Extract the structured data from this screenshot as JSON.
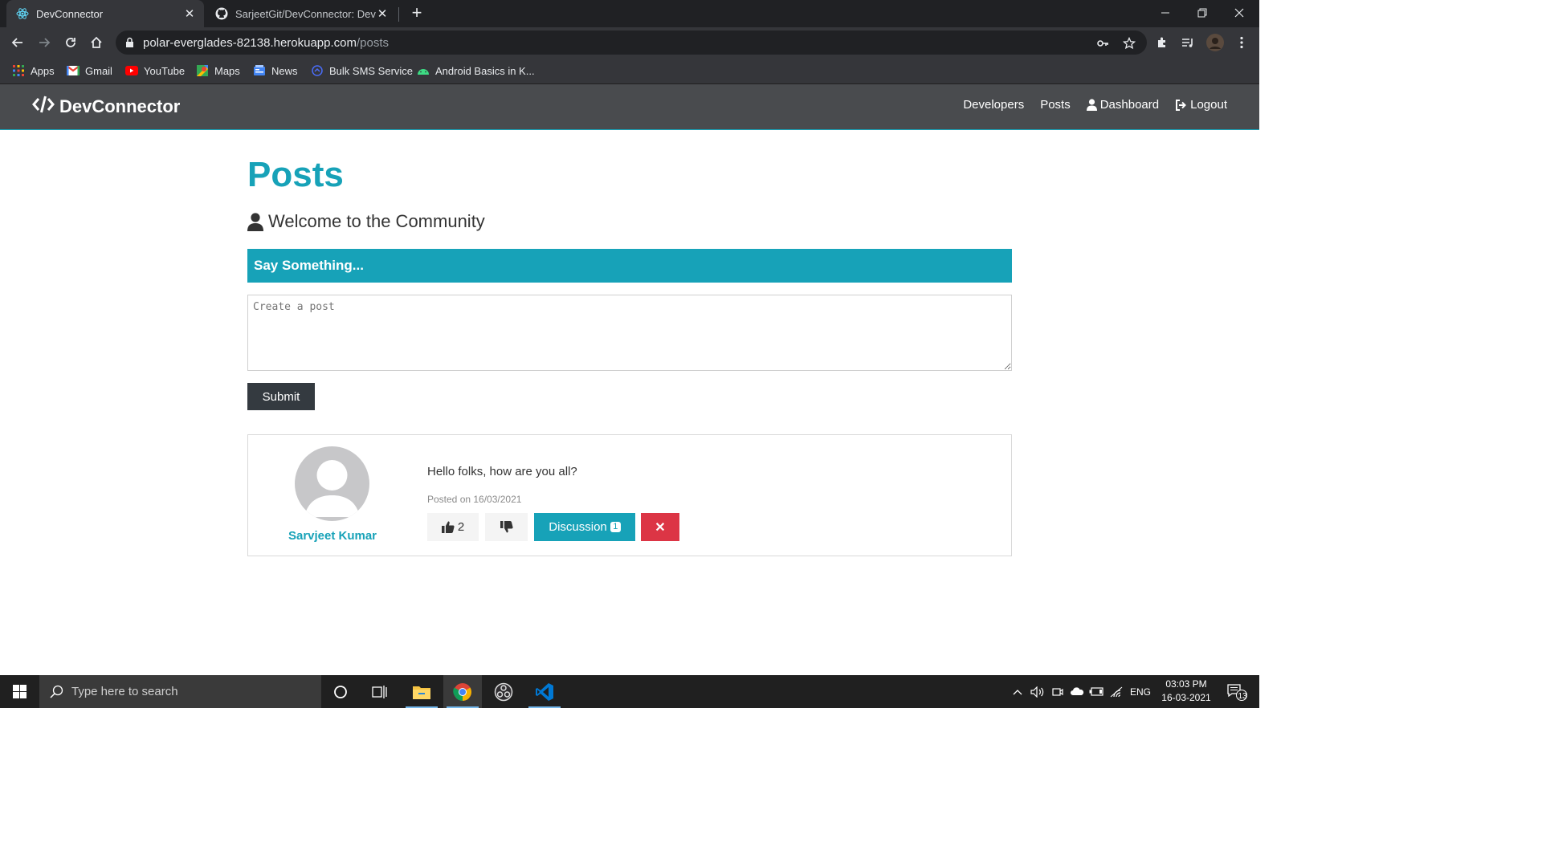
{
  "browser": {
    "tabs": [
      {
        "title": "DevConnector",
        "active": true
      },
      {
        "title": "SarjeetGit/DevConnector: DevC",
        "active": false
      }
    ],
    "url_host": "polar-everglades-82138.herokuapp.com",
    "url_path": "/posts",
    "bookmarks": [
      "Apps",
      "Gmail",
      "YouTube",
      "Maps",
      "News",
      "Bulk SMS Service",
      "Android Basics in K..."
    ]
  },
  "app": {
    "brand": "DevConnector",
    "nav": {
      "developers": "Developers",
      "posts": "Posts",
      "dashboard": "Dashboard",
      "logout": "Logout"
    },
    "accent_color": "#17a2b8"
  },
  "page": {
    "title": "Posts",
    "lead": "Welcome to the Community",
    "form_header": "Say Something...",
    "textarea_placeholder": "Create a post",
    "submit_label": "Submit"
  },
  "posts": [
    {
      "author": "Sarvjeet Kumar",
      "text": "Hello folks, how are you all?",
      "date": "Posted on 16/03/2021",
      "likes": "2",
      "discussion_label": "Discussion",
      "comment_count": "1",
      "delete_label": "✕"
    }
  ],
  "taskbar": {
    "search_placeholder": "Type here to search",
    "language": "ENG",
    "time": "03:03 PM",
    "date": "16-03-2021",
    "notification_count": "13"
  }
}
